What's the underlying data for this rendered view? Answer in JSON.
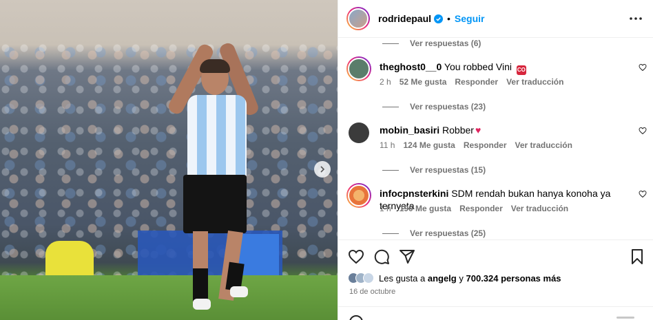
{
  "post": {
    "author": "rodridepaul",
    "separator": "•",
    "follow_label": "Seguir",
    "carousel_next_icon": "chevron-right-icon",
    "more_icon": "ellipsis-icon"
  },
  "thread": [
    {
      "type": "replies",
      "label": "Ver respuestas (6)"
    },
    {
      "type": "comment",
      "username": "theghost0__0",
      "text": "You robbed Vini",
      "emoji": "CO",
      "time": "2 h",
      "likes": "52 Me gusta",
      "reply_label": "Responder",
      "translate_label": "Ver traducción",
      "avatar_color": "#5b7d6b"
    },
    {
      "type": "replies",
      "label": "Ver respuestas (23)"
    },
    {
      "type": "comment",
      "username": "mobin_basiri",
      "text": "Robber",
      "emoji": "♥",
      "time": "11 h",
      "likes": "124 Me gusta",
      "reply_label": "Responder",
      "translate_label": "Ver traducción",
      "avatar_color": "#3b3b3b"
    },
    {
      "type": "replies",
      "label": "Ver respuestas (15)"
    },
    {
      "type": "comment",
      "username": "infocpnsterkini",
      "text": "SDM rendah bukan hanya konoha ya ternyata",
      "emoji": "",
      "time": "1 h",
      "likes": "190 Me gusta",
      "reply_label": "Responder",
      "translate_label": "Ver traducción",
      "avatar_color": "#e8743b"
    },
    {
      "type": "replies",
      "label": "Ver respuestas (25)"
    }
  ],
  "likes_summary": {
    "prefix": "Les gusta a",
    "first_user": "angelg",
    "connector": "y",
    "others": "700.324 personas más"
  },
  "date": "16 de octubre",
  "colors": {
    "accent": "#0095f6",
    "muted": "#737373",
    "border": "#efefef",
    "story_ring": [
      "#f9ce34",
      "#ee2a7b",
      "#6228d7"
    ]
  }
}
